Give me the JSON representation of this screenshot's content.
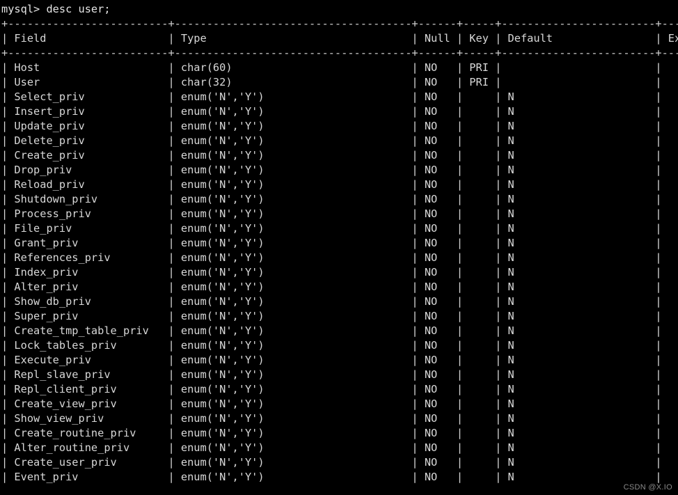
{
  "terminal": {
    "prompt": "mysql>",
    "command": "desc user;",
    "prompt_line": "mysql> desc user;",
    "watermark": "CSDN @X.IO",
    "background_color": "#000000",
    "text_color": "#d8d8d8",
    "border_chars": {
      "cross": "+",
      "horizontal": "-",
      "vertical": "|"
    }
  },
  "table": {
    "columns": [
      {
        "header": "Field",
        "width": 25
      },
      {
        "header": "Type",
        "width": 37
      },
      {
        "header": "Null",
        "width": 6
      },
      {
        "header": "Key",
        "width": 5
      },
      {
        "header": "Default",
        "width": 24
      },
      {
        "header": "Extra",
        "width": 8
      }
    ],
    "rows": [
      {
        "Field": "Host",
        "Type": "char(60)",
        "Null": "NO",
        "Key": "PRI",
        "Default": "",
        "Extra": ""
      },
      {
        "Field": "User",
        "Type": "char(32)",
        "Null": "NO",
        "Key": "PRI",
        "Default": "",
        "Extra": ""
      },
      {
        "Field": "Select_priv",
        "Type": "enum('N','Y')",
        "Null": "NO",
        "Key": "",
        "Default": "N",
        "Extra": ""
      },
      {
        "Field": "Insert_priv",
        "Type": "enum('N','Y')",
        "Null": "NO",
        "Key": "",
        "Default": "N",
        "Extra": ""
      },
      {
        "Field": "Update_priv",
        "Type": "enum('N','Y')",
        "Null": "NO",
        "Key": "",
        "Default": "N",
        "Extra": ""
      },
      {
        "Field": "Delete_priv",
        "Type": "enum('N','Y')",
        "Null": "NO",
        "Key": "",
        "Default": "N",
        "Extra": ""
      },
      {
        "Field": "Create_priv",
        "Type": "enum('N','Y')",
        "Null": "NO",
        "Key": "",
        "Default": "N",
        "Extra": ""
      },
      {
        "Field": "Drop_priv",
        "Type": "enum('N','Y')",
        "Null": "NO",
        "Key": "",
        "Default": "N",
        "Extra": ""
      },
      {
        "Field": "Reload_priv",
        "Type": "enum('N','Y')",
        "Null": "NO",
        "Key": "",
        "Default": "N",
        "Extra": ""
      },
      {
        "Field": "Shutdown_priv",
        "Type": "enum('N','Y')",
        "Null": "NO",
        "Key": "",
        "Default": "N",
        "Extra": ""
      },
      {
        "Field": "Process_priv",
        "Type": "enum('N','Y')",
        "Null": "NO",
        "Key": "",
        "Default": "N",
        "Extra": ""
      },
      {
        "Field": "File_priv",
        "Type": "enum('N','Y')",
        "Null": "NO",
        "Key": "",
        "Default": "N",
        "Extra": ""
      },
      {
        "Field": "Grant_priv",
        "Type": "enum('N','Y')",
        "Null": "NO",
        "Key": "",
        "Default": "N",
        "Extra": ""
      },
      {
        "Field": "References_priv",
        "Type": "enum('N','Y')",
        "Null": "NO",
        "Key": "",
        "Default": "N",
        "Extra": ""
      },
      {
        "Field": "Index_priv",
        "Type": "enum('N','Y')",
        "Null": "NO",
        "Key": "",
        "Default": "N",
        "Extra": ""
      },
      {
        "Field": "Alter_priv",
        "Type": "enum('N','Y')",
        "Null": "NO",
        "Key": "",
        "Default": "N",
        "Extra": ""
      },
      {
        "Field": "Show_db_priv",
        "Type": "enum('N','Y')",
        "Null": "NO",
        "Key": "",
        "Default": "N",
        "Extra": ""
      },
      {
        "Field": "Super_priv",
        "Type": "enum('N','Y')",
        "Null": "NO",
        "Key": "",
        "Default": "N",
        "Extra": ""
      },
      {
        "Field": "Create_tmp_table_priv",
        "Type": "enum('N','Y')",
        "Null": "NO",
        "Key": "",
        "Default": "N",
        "Extra": ""
      },
      {
        "Field": "Lock_tables_priv",
        "Type": "enum('N','Y')",
        "Null": "NO",
        "Key": "",
        "Default": "N",
        "Extra": ""
      },
      {
        "Field": "Execute_priv",
        "Type": "enum('N','Y')",
        "Null": "NO",
        "Key": "",
        "Default": "N",
        "Extra": ""
      },
      {
        "Field": "Repl_slave_priv",
        "Type": "enum('N','Y')",
        "Null": "NO",
        "Key": "",
        "Default": "N",
        "Extra": ""
      },
      {
        "Field": "Repl_client_priv",
        "Type": "enum('N','Y')",
        "Null": "NO",
        "Key": "",
        "Default": "N",
        "Extra": ""
      },
      {
        "Field": "Create_view_priv",
        "Type": "enum('N','Y')",
        "Null": "NO",
        "Key": "",
        "Default": "N",
        "Extra": ""
      },
      {
        "Field": "Show_view_priv",
        "Type": "enum('N','Y')",
        "Null": "NO",
        "Key": "",
        "Default": "N",
        "Extra": ""
      },
      {
        "Field": "Create_routine_priv",
        "Type": "enum('N','Y')",
        "Null": "NO",
        "Key": "",
        "Default": "N",
        "Extra": ""
      },
      {
        "Field": "Alter_routine_priv",
        "Type": "enum('N','Y')",
        "Null": "NO",
        "Key": "",
        "Default": "N",
        "Extra": ""
      },
      {
        "Field": "Create_user_priv",
        "Type": "enum('N','Y')",
        "Null": "NO",
        "Key": "",
        "Default": "N",
        "Extra": ""
      },
      {
        "Field": "Event_priv",
        "Type": "enum('N','Y')",
        "Null": "NO",
        "Key": "",
        "Default": "N",
        "Extra": ""
      }
    ]
  }
}
